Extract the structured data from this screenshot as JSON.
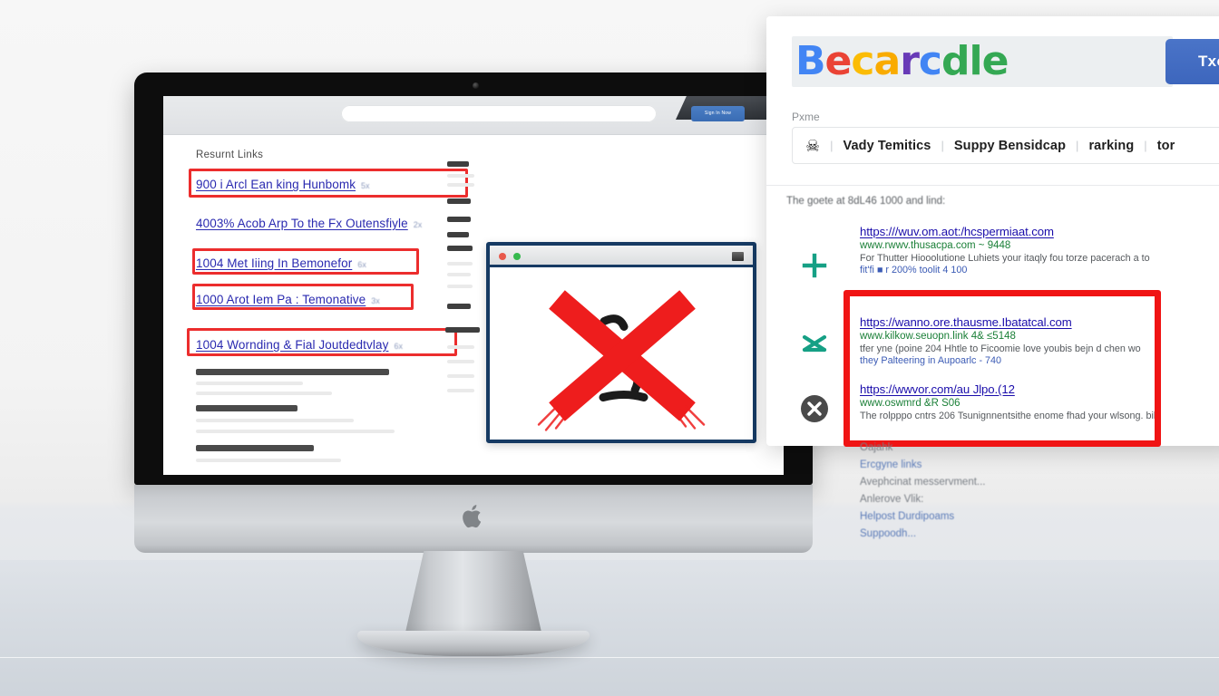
{
  "scene": {
    "background_color": "#f3f3f3",
    "desk_color": "#d7dce2"
  },
  "monitor": {
    "device_name": "imac-desktop-computer",
    "bezel_color": "#0d0d0d",
    "chin_color": "#c9ccd0",
    "brand_logo": "apple-logo"
  },
  "browser": {
    "url_bar_value": "",
    "cta_label": "Sign In Now",
    "tab_strip": "dark-tab"
  },
  "page": {
    "title": "Resurnt Links",
    "links": [
      {
        "text": "900 i Arcl Ean king Hunbomk",
        "suffix": "5x",
        "highlighted": true
      },
      {
        "text": "4003% Acob Arp To the Fx Outensfiyle",
        "suffix": "2x",
        "highlighted": false
      },
      {
        "text": "1004 Met Iiing In Bemonefor",
        "suffix": "6x",
        "highlighted": true
      },
      {
        "text": "1000 Arot Iem Pa : Temonative",
        "suffix": "3x",
        "highlighted": true
      },
      {
        "text": "1004 Wornding & Fial Joutdedtvlay",
        "suffix": "6x",
        "highlighted": true
      }
    ],
    "skeleton_rows": 6
  },
  "inner_window": {
    "name": "blocked-site-window",
    "title_dots": [
      "red",
      "green"
    ],
    "content_icon": "red-x-mark",
    "frame_color": "#163a63"
  },
  "search_panel": {
    "logo": {
      "text": "Becarcle",
      "letters": [
        {
          "ch": "B",
          "color": "#4285F4"
        },
        {
          "ch": "e",
          "color": "#EA4335"
        },
        {
          "ch": "c",
          "color": "#FBBC05"
        },
        {
          "ch": "a",
          "color": "#F9AB00"
        },
        {
          "ch": "r",
          "color": "#673AB7"
        },
        {
          "ch": "c",
          "color": "#4285F4"
        },
        {
          "ch": "d",
          "color": "#34A853"
        },
        {
          "ch": "l",
          "color": "#34A853"
        },
        {
          "ch": "e",
          "color": "#34A853"
        }
      ]
    },
    "cta_label": "Txo",
    "cta_color": "#3d66bd",
    "sublabel": "Pxme",
    "nav": {
      "glyph_icon": "person-figure-icon",
      "items": [
        "Vady Temitics",
        "Suppy Bensidcap",
        "rarking",
        "tor"
      ],
      "separator": "|"
    },
    "results_intro": "The goete at 8dL46 1000 and lind:",
    "results": [
      {
        "icon": "green-plus-icon",
        "url": "https:///wuv.om.aot:/hcspermiaat.com",
        "site": "www.rwwv.thusacpa.com  ~ 9448",
        "desc": "For Thutter Hiooolutione Luhiets your itaqly fou torze pacerach a to",
        "meta": "fit'fi ■ r 200% toolit 4 100",
        "highlighted": false
      },
      {
        "icon": "green-x-icon",
        "url": "https://wanno.ore.thausme.Ibatatcal.com",
        "site": "www.kilkow.seuopn.link 4& ≤5148",
        "desc": "tfer yne (poine 204 Hhtle to Ficoomie love youbis bejn  d chen wo",
        "meta": "they Palteering in Aupoarlc - 740",
        "highlighted": true
      },
      {
        "icon": "dark-circle-x-icon",
        "url": "https://wwvor.com/au Jlpo.(12",
        "site": "www.oswmrd  &R S06",
        "desc": "The rolpppo cntrs 206 Tsunignnentsithe enome fhad your  wlsong. bil",
        "meta": "",
        "highlighted": true
      }
    ],
    "side_list": [
      {
        "text": "Oajahk",
        "is_link": false
      },
      {
        "text": "Ercgyne links",
        "is_link": true
      },
      {
        "text": "Avephcinat messervment...",
        "is_link": false
      },
      {
        "text": "Anlerove Vlik:",
        "is_link": false
      },
      {
        "text": "Helpost Durdipoams",
        "is_link": true
      },
      {
        "text": "Suppoodh...",
        "is_link": true
      }
    ],
    "highlight_color": "#f01414"
  }
}
